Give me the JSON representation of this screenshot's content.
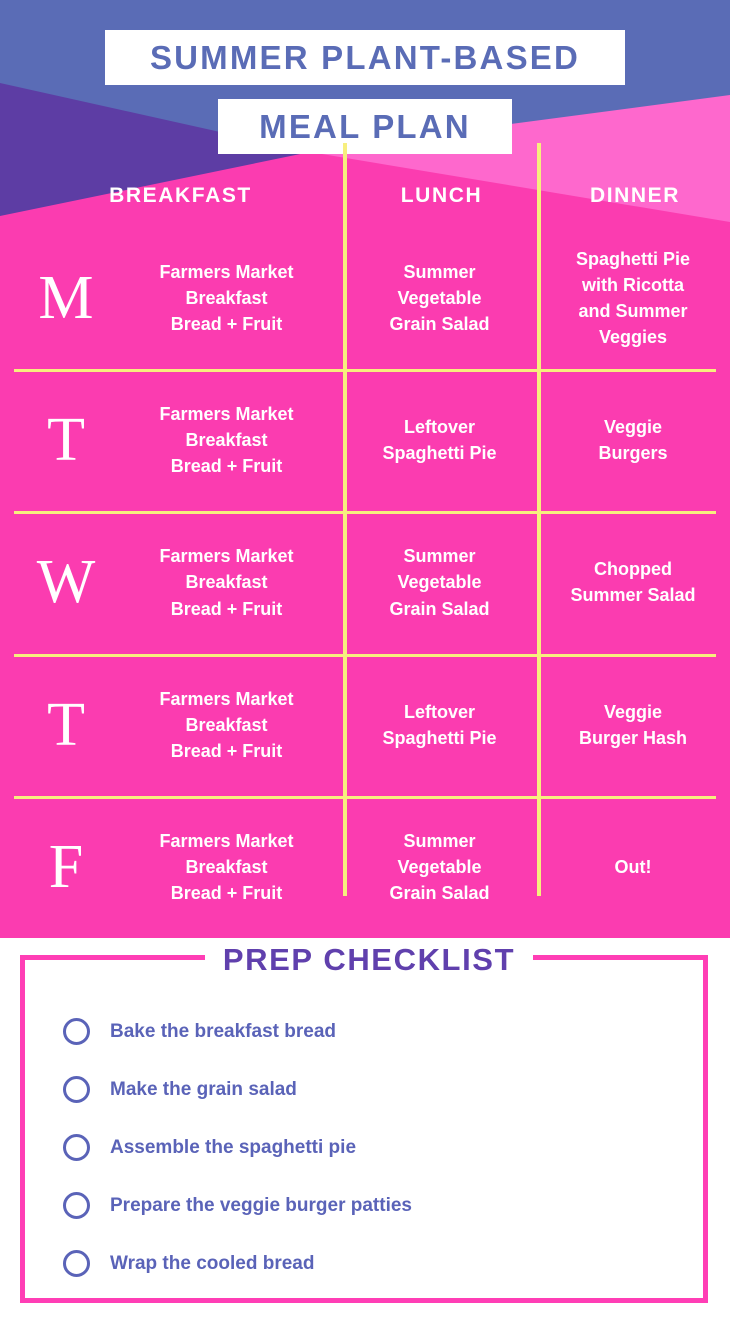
{
  "header": {
    "title_line_1": "SUMMER PLANT-BASED",
    "title_line_2": "MEAL PLAN"
  },
  "colors": {
    "periwinkle": "#5a6cb6",
    "deep_purple": "#5d3da4",
    "magenta": "#fb3cb0",
    "light_pink": "#fe68cd",
    "yellow_rule": "#f7ef7e",
    "white": "#ffffff",
    "checklist_border": "#ff3eb5",
    "checklist_title": "#6040ad",
    "checklist_text": "#5a63b8"
  },
  "meal_table": {
    "columns": [
      "BREAKFAST",
      "LUNCH",
      "DINNER"
    ],
    "rows": [
      {
        "day_letter": "M",
        "breakfast": "Farmers Market\nBreakfast\nBread + Fruit",
        "lunch": "Summer\nVegetable\nGrain Salad",
        "dinner": "Spaghetti Pie\nwith Ricotta\nand Summer\nVeggies"
      },
      {
        "day_letter": "T",
        "breakfast": "Farmers Market\nBreakfast\nBread + Fruit",
        "lunch": "Leftover\nSpaghetti Pie",
        "dinner": "Veggie\nBurgers"
      },
      {
        "day_letter": "W",
        "breakfast": "Farmers Market\nBreakfast\nBread + Fruit",
        "lunch": "Summer\nVegetable\nGrain Salad",
        "dinner": "Chopped\nSummer Salad"
      },
      {
        "day_letter": "T",
        "breakfast": "Farmers Market\nBreakfast\nBread + Fruit",
        "lunch": "Leftover\nSpaghetti Pie",
        "dinner": "Veggie\nBurger Hash"
      },
      {
        "day_letter": "F",
        "breakfast": "Farmers Market\nBreakfast\nBread + Fruit",
        "lunch": "Summer\nVegetable\nGrain Salad",
        "dinner": "Out!"
      }
    ]
  },
  "checklist": {
    "title": "PREP CHECKLIST",
    "items": [
      {
        "label": "Bake the breakfast bread",
        "checked": false
      },
      {
        "label": "Make the grain salad",
        "checked": false
      },
      {
        "label": "Assemble the spaghetti pie",
        "checked": false
      },
      {
        "label": "Prepare the veggie burger patties",
        "checked": false
      },
      {
        "label": "Wrap the cooled bread",
        "checked": false
      }
    ]
  }
}
